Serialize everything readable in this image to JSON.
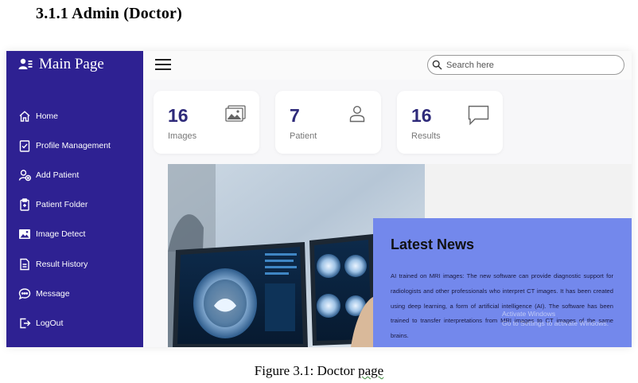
{
  "doc": {
    "heading": "3.1.1 Admin  (Doctor)",
    "caption_prefix": "Figure 3.1: Doctor ",
    "caption_word": "page"
  },
  "sidebar": {
    "title": "Main Page",
    "items": [
      {
        "label": "Home",
        "icon": "home-icon"
      },
      {
        "label": "Profile Management",
        "icon": "clipboard-check-icon"
      },
      {
        "label": "Add Patient",
        "icon": "user-plus-icon"
      },
      {
        "label": "Patient Folder",
        "icon": "folder-clipboard-icon"
      },
      {
        "label": "Image Detect",
        "icon": "image-icon"
      },
      {
        "label": "Result History",
        "icon": "document-icon"
      },
      {
        "label": "Message",
        "icon": "chat-bubble-icon"
      },
      {
        "label": "LogOut",
        "icon": "logout-icon"
      }
    ]
  },
  "search": {
    "placeholder": "Search here"
  },
  "stats": [
    {
      "value": "16",
      "label": "Images",
      "icon": "images-icon"
    },
    {
      "value": "7",
      "label": "Patient",
      "icon": "person-icon"
    },
    {
      "value": "16",
      "label": "Results",
      "icon": "message-square-icon"
    }
  ],
  "news": {
    "title": "Latest News",
    "text": "AI trained on MRI images: The new software can provide diagnostic support for radiologists and other professionals who interpret CT images. It has been created using deep learning, a form of artificial intelligence (AI). The software has been trained to transfer interpretations from MRI images to CT images of the same brains.",
    "watermark_line1": "Activate Windows",
    "watermark_line2": "Go to Settings to activate Windows."
  },
  "colors": {
    "sidebar": "#2e2192",
    "news_panel": "#7388ec",
    "stat_number": "#2e2a7a"
  }
}
